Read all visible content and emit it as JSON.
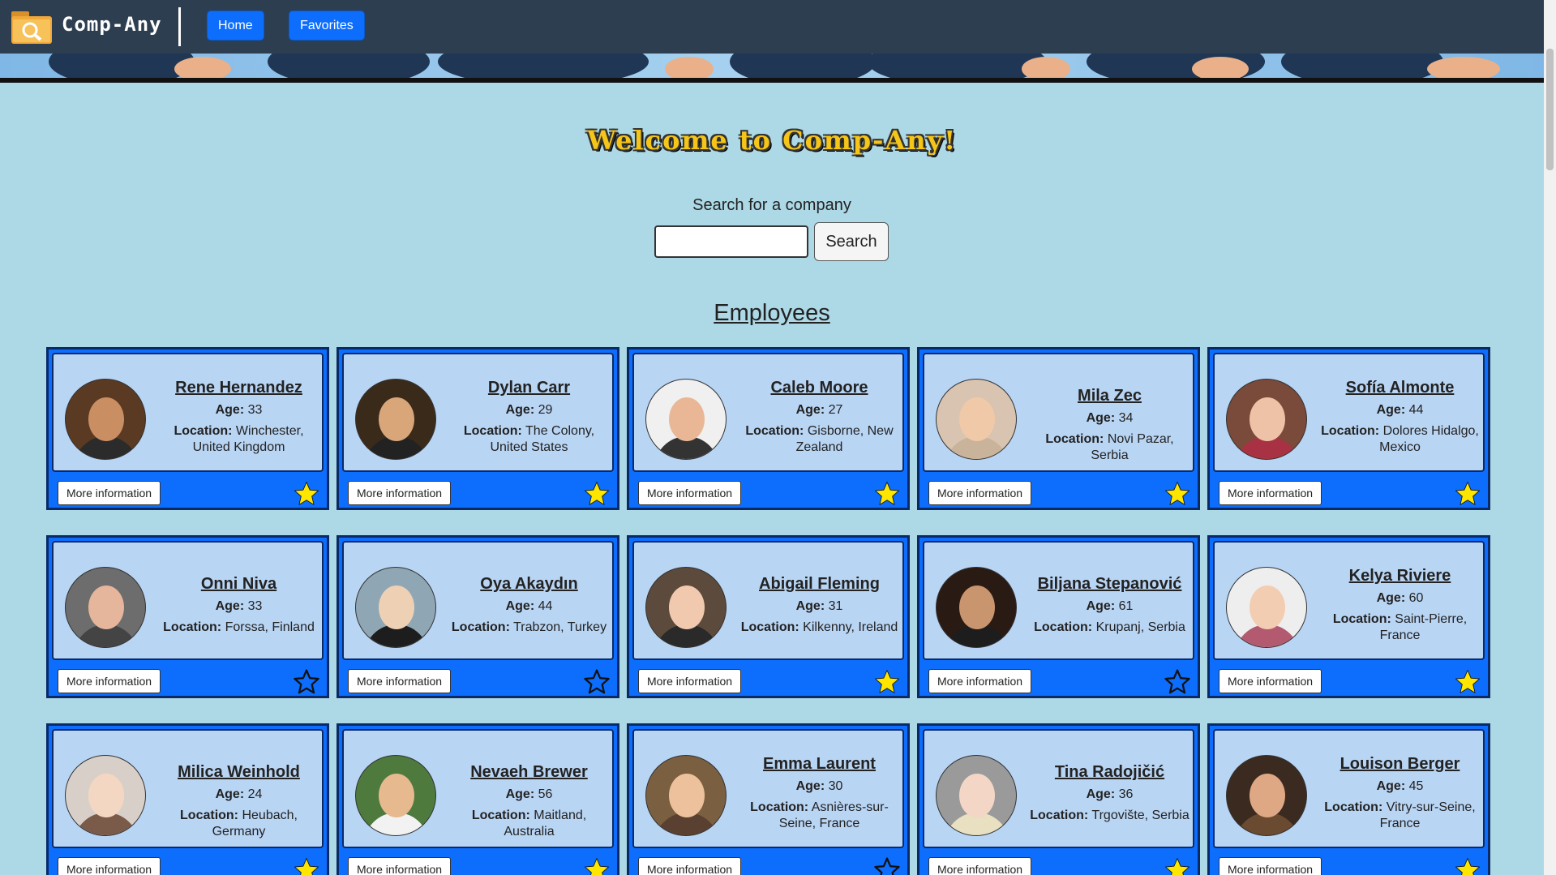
{
  "nav": {
    "brand": "Comp-Any",
    "links": [
      {
        "label": "Home"
      },
      {
        "label": "Favorites"
      }
    ]
  },
  "main": {
    "welcome": "Welcome to Comp-Any!",
    "search_label": "Search for a company",
    "search_value": "",
    "search_button": "Search",
    "section_title": "Employees"
  },
  "labels": {
    "age": "Age:",
    "location": "Location:",
    "more_info": "More information"
  },
  "colors": {
    "background": "#add8e6",
    "navbar": "#2c3e50",
    "primary": "#0d6efd",
    "star_filled": "#ffe600"
  },
  "employees": [
    {
      "name": "Rene Hernandez",
      "age": "33",
      "location": "Winchester, United Kingdom",
      "favorite": true
    },
    {
      "name": "Dylan Carr",
      "age": "29",
      "location": "The Colony, United States",
      "favorite": true
    },
    {
      "name": "Caleb Moore",
      "age": "27",
      "location": "Gisborne, New Zealand",
      "favorite": true
    },
    {
      "name": "Mila Zec",
      "age": "34",
      "location": "Novi Pazar, Serbia",
      "favorite": true
    },
    {
      "name": "Sofía Almonte",
      "age": "44",
      "location": "Dolores Hidalgo, Mexico",
      "favorite": true
    },
    {
      "name": "Onni Niva",
      "age": "33",
      "location": "Forssa, Finland",
      "favorite": false
    },
    {
      "name": "Oya Akaydın",
      "age": "44",
      "location": "Trabzon, Turkey",
      "favorite": false
    },
    {
      "name": "Abigail Fleming",
      "age": "31",
      "location": "Kilkenny, Ireland",
      "favorite": true
    },
    {
      "name": "Biljana Stepanović",
      "age": "61",
      "location": "Krupanj, Serbia",
      "favorite": false
    },
    {
      "name": "Kelya Riviere",
      "age": "60",
      "location": "Saint-Pierre, France",
      "favorite": true
    },
    {
      "name": "Milica Weinhold",
      "age": "24",
      "location": "Heubach, Germany",
      "favorite": true
    },
    {
      "name": "Nevaeh Brewer",
      "age": "56",
      "location": "Maitland, Australia",
      "favorite": true
    },
    {
      "name": "Emma Laurent",
      "age": "30",
      "location": "Asnières-sur-Seine, France",
      "favorite": false
    },
    {
      "name": "Tina Radojičić",
      "age": "36",
      "location": "Trgovište, Serbia",
      "favorite": true
    },
    {
      "name": "Louison Berger",
      "age": "45",
      "location": "Vitry-sur-Seine, France",
      "favorite": true
    }
  ]
}
